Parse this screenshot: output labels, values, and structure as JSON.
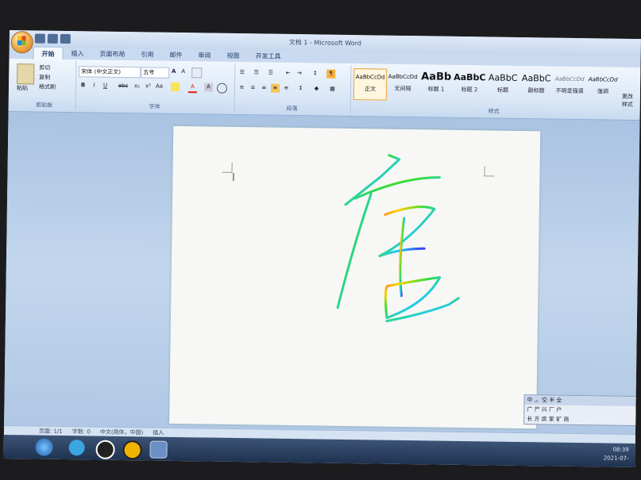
{
  "window": {
    "title": "文档 1 - Microsoft Word"
  },
  "tabs": [
    "开始",
    "插入",
    "页面布局",
    "引用",
    "邮件",
    "审阅",
    "视图",
    "开发工具"
  ],
  "clipboard": {
    "paste": "粘贴",
    "cut": "剪切",
    "copy": "复制",
    "format_painter": "格式刷",
    "label": "剪贴板"
  },
  "font": {
    "name": "宋体 (中文正文)",
    "size": "五号",
    "label": "字体",
    "bold": "B",
    "italic": "I",
    "underline": "U",
    "strike": "abc",
    "sub": "x₂",
    "sup": "x²",
    "case": "Aa",
    "grow": "A",
    "shrink": "A",
    "color_a": "A",
    "border_a": "A"
  },
  "paragraph": {
    "label": "段落"
  },
  "styles": {
    "label": "样式",
    "items": [
      {
        "preview": "AaBbCcDd",
        "name": "正文"
      },
      {
        "preview": "AaBbCcDd",
        "name": "无间隔"
      },
      {
        "preview": "AaBb",
        "name": "标题 1"
      },
      {
        "preview": "AaBbC",
        "name": "标题 2"
      },
      {
        "preview": "AaBbC",
        "name": "标题"
      },
      {
        "preview": "AaBbC",
        "name": "副标题"
      },
      {
        "preview": "AaBbCcDd",
        "name": "不明显强调"
      },
      {
        "preview": "AaBbCcDd",
        "name": "强调"
      }
    ],
    "change": "更改样式"
  },
  "status": {
    "page": "页面: 1/1",
    "words": "字数: 0",
    "lang": "中文(简体，中国)",
    "mode": "插入"
  },
  "ime": {
    "row1": "中 ,。空 半 全",
    "row2": "广 尸 兴 厂 户",
    "row3": "长 方 房 家 矿 商"
  },
  "tray": {
    "time": "08:39",
    "date": "2021-07-"
  },
  "colors": {
    "ribbon": "#dbe7f5",
    "accent": "#e8a33b"
  }
}
